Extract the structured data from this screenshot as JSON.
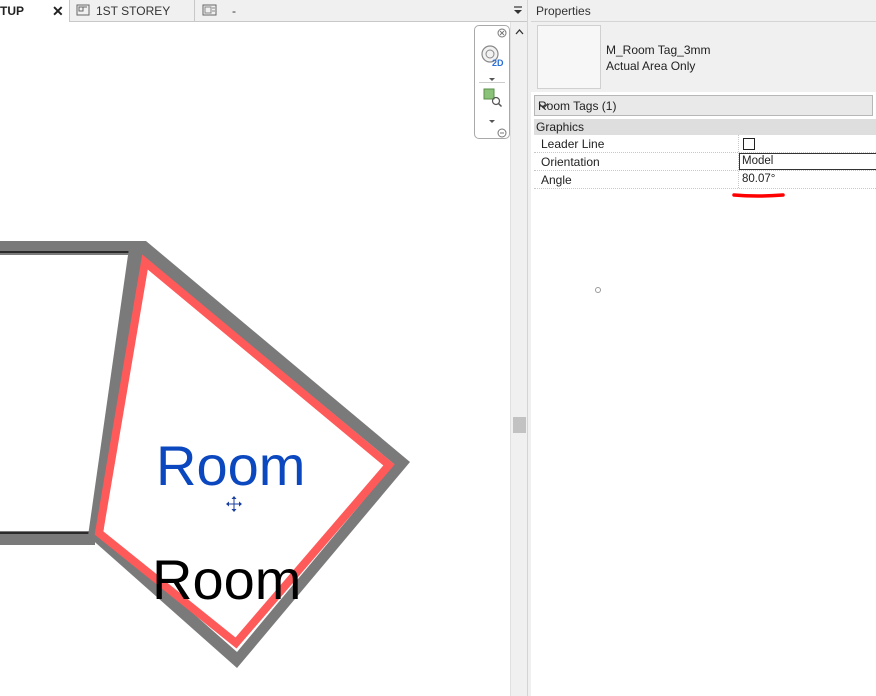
{
  "tabs": [
    {
      "label": "TUP",
      "active": true,
      "close": "✕"
    },
    {
      "label": "1ST STOREY",
      "active": false
    },
    {
      "label": "-",
      "active": false
    }
  ],
  "view": {
    "room_tag_label": "Room",
    "room_name_label": "Room",
    "nav": {
      "wheel_label": "2D"
    }
  },
  "colors": {
    "wall": "#7a7a7a",
    "room_boundary": "#ff5a5a",
    "tag_text": "#0b47bf",
    "annotation": "#ff0000"
  },
  "properties": {
    "title": "Properties",
    "type_name": "M_Room Tag_3mm",
    "type_subtitle": "Actual Area Only",
    "selector": "Room Tags (1)",
    "group": "Graphics",
    "rows": [
      {
        "label": "Leader Line",
        "type": "checkbox",
        "checked": false
      },
      {
        "label": "Orientation",
        "value": "Model"
      },
      {
        "label": "Angle",
        "value": "80.07°"
      }
    ]
  }
}
